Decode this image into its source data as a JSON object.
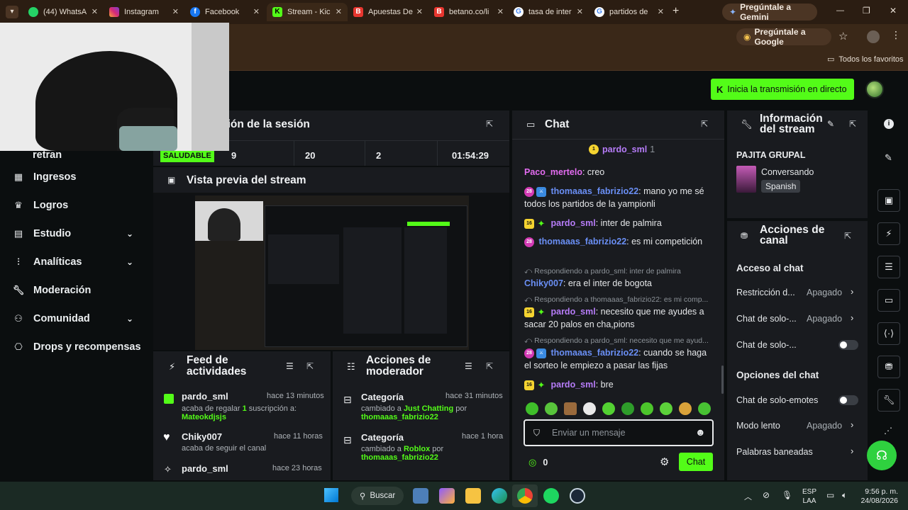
{
  "browser": {
    "tabs": [
      {
        "label": "(44) WhatsA",
        "icon": "whatsapp-icon"
      },
      {
        "label": "Instagram",
        "icon": "instagram-icon"
      },
      {
        "label": "Facebook",
        "icon": "facebook-icon"
      },
      {
        "label": "Stream - Kic",
        "icon": "kick-icon",
        "active": true
      },
      {
        "label": "Apuestas De",
        "icon": "betano-icon"
      },
      {
        "label": "betano.co/li",
        "icon": "betano-icon"
      },
      {
        "label": "tasa de inter",
        "icon": "google-icon"
      },
      {
        "label": "partidos de",
        "icon": "google-icon"
      }
    ],
    "new_tab": "+",
    "gemini_button": "Pregúntale a Gemini",
    "google_pill": "Pregúntale a Google",
    "favorites": "Todos los favoritos",
    "window_controls": [
      "—",
      "❐",
      "✕"
    ]
  },
  "app": {
    "go_live": "Inicia la transmisión en directo",
    "colors": {
      "accent": "#53fc18",
      "panel": "#191b1f",
      "bg": "#0b0e0f"
    }
  },
  "sidebar": {
    "partial_item": "Servidor y clave de retran",
    "items": [
      {
        "label": "Ingresos",
        "icon": "revenue-icon"
      },
      {
        "label": "Logros",
        "icon": "trophy-icon"
      },
      {
        "label": "Estudio",
        "icon": "studio-icon",
        "chevron": true
      },
      {
        "label": "Analíticas",
        "icon": "analytics-icon",
        "chevron": true
      },
      {
        "label": "Moderación",
        "icon": "wrench-icon"
      },
      {
        "label": "Comunidad",
        "icon": "community-icon",
        "chevron": true
      },
      {
        "label": "Drops y recompensas",
        "icon": "gift-icon"
      }
    ]
  },
  "session": {
    "title": "ción de la sesión",
    "status": "SALUDABLE",
    "stats": [
      "9",
      "20",
      "2",
      "01:54:29"
    ]
  },
  "preview": {
    "title": "Vista previa del stream"
  },
  "feed": {
    "title_line1": "Feed de",
    "title_line2": "actividades",
    "items": [
      {
        "name": "pardo_sml",
        "time": "hace 13 minutos",
        "desc_pre": "acaba de regalar ",
        "desc_hl": "1",
        "desc_post": " suscripción a:",
        "desc_hl2": "Mateokdjsjs"
      },
      {
        "name": "Chiky007",
        "time": "hace 11 horas",
        "desc_pre": "acaba de seguir el canal"
      },
      {
        "name": "pardo_sml",
        "time": "hace 23 horas"
      }
    ]
  },
  "modactions": {
    "title_line1": "Acciones de",
    "title_line2": "moderador",
    "items": [
      {
        "name": "Categoría",
        "time": "hace 31 minutos",
        "pre": "cambiado a ",
        "hl": "Just Chatting",
        "post": " por",
        "by": "thomaaas_fabrizio22"
      },
      {
        "name": "Categoría",
        "time": "hace 1 hora",
        "pre": "cambiado a ",
        "hl": "Roblox",
        "post": " por",
        "by": "thomaaas_fabrizio22"
      }
    ]
  },
  "chat": {
    "title": "Chat",
    "pinned_user": "pardo_sml",
    "pinned_count": "1",
    "messages": [
      {
        "user": "Paco_mertelo",
        "text": ": creo"
      },
      {
        "user": "thomaaas_fabrizio22",
        "text": ": mano yo me sé todos los partidos de la yampionli"
      },
      {
        "user": "pardo_sml",
        "text": ": inter de palmira"
      },
      {
        "user": "thomaaas_fabrizio22",
        "text": ": es mi competición"
      },
      {
        "reply": "Respondiendo a pardo_sml: inter de palmira",
        "user": "Chiky007",
        "text": ": era el inter de bogota"
      },
      {
        "reply": "Respondiendo a thomaaas_fabrizio22: es mi comp...",
        "user": "pardo_sml",
        "text": ": necesito que me ayudes a sacar 20 palos en cha,pions"
      },
      {
        "reply": "Respondiendo a pardo_sml: necesito que me ayud...",
        "user": "thomaaas_fabrizio22",
        "text": ": cuando se haga el sorteo le empiezo a pasar las fijas"
      },
      {
        "user": "pardo_sml",
        "text": ": bre"
      }
    ],
    "badges": {
      "sub_28": "28",
      "sub_16": "16"
    },
    "input_placeholder": "Enviar un mensaje",
    "points": "0",
    "send_label": "Chat"
  },
  "stream_info": {
    "title_line1": "Información",
    "title_line2": "del stream",
    "stream_title": "PAJITA GRUPAL",
    "category": "Conversando",
    "language": "Spanish"
  },
  "channel_actions": {
    "title_line1": "Acciones de",
    "title_line2": "canal",
    "section_access": "Acceso al chat",
    "rows_access": [
      {
        "label": "Restricción d...",
        "value": "Apagado",
        "chevron": true
      },
      {
        "label": "Chat de solo-...",
        "value": "Apagado",
        "chevron": true
      },
      {
        "label": "Chat de solo-...",
        "toggle": true
      }
    ],
    "section_options": "Opciones del chat",
    "rows_options": [
      {
        "label": "Chat de solo-emotes",
        "toggle": true
      },
      {
        "label": "Modo lento",
        "value": "Apagado",
        "chevron": true
      },
      {
        "label": "Palabras baneadas",
        "chevron": true
      }
    ]
  },
  "taskbar": {
    "search": "Buscar",
    "lang_top": "ESP",
    "lang_bottom": "LAA",
    "time": "9:56 p. m.",
    "date": "24/08/2026"
  }
}
